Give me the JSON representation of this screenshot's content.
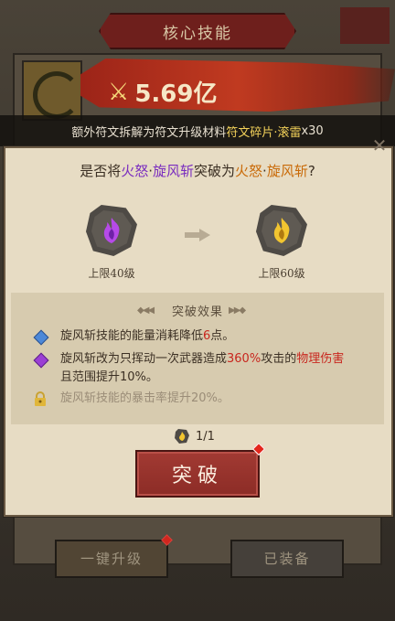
{
  "background": {
    "title": "核心技能",
    "power_value": "5.69亿",
    "buttons": {
      "upgrade_all": "一键升级",
      "equipped": "已装备"
    }
  },
  "notice": {
    "prefix": "额外符文拆解为符文升级材料",
    "item": "符文碎片·滚雷",
    "count": "x30"
  },
  "dialog": {
    "question": {
      "pre": "是否将",
      "from_a": "火怒",
      "dot1": "·",
      "from_b": "旋风斩",
      "mid": "突破为",
      "to_a": "火怒",
      "dot2": "·",
      "to_b": "旋风斩",
      "end": "?"
    },
    "from_rune": {
      "label": "上限40级",
      "icon": "purple-flame-rune-icon",
      "color": "#9b3fd4"
    },
    "to_rune": {
      "label": "上限60级",
      "icon": "gold-flame-rune-icon",
      "color": "#e6b92a"
    },
    "effects_title": "突破效果",
    "effects": [
      {
        "icon": "blue-gem-icon",
        "text_pre": "旋风斩技能的能量消耗降低",
        "highlight": "6",
        "text_post": "点。"
      },
      {
        "icon": "purple-gem-icon",
        "line1_pre": "旋风斩改为只挥动一次武器造成",
        "highlight": "360%",
        "line1_mid": "攻击的",
        "highlight2": "物理伤害",
        "line2": "且范围提升10%。"
      },
      {
        "icon": "lock-icon",
        "text": "旋风斩技能的暴击率提升20%。",
        "locked": true
      }
    ],
    "cost": "1/1",
    "break_button": "突破"
  },
  "colors": {
    "accent_red": "#c8261e",
    "purple": "#7a2dbf",
    "gold": "#c96a08",
    "dialog_bg": "#e7dcc4"
  }
}
